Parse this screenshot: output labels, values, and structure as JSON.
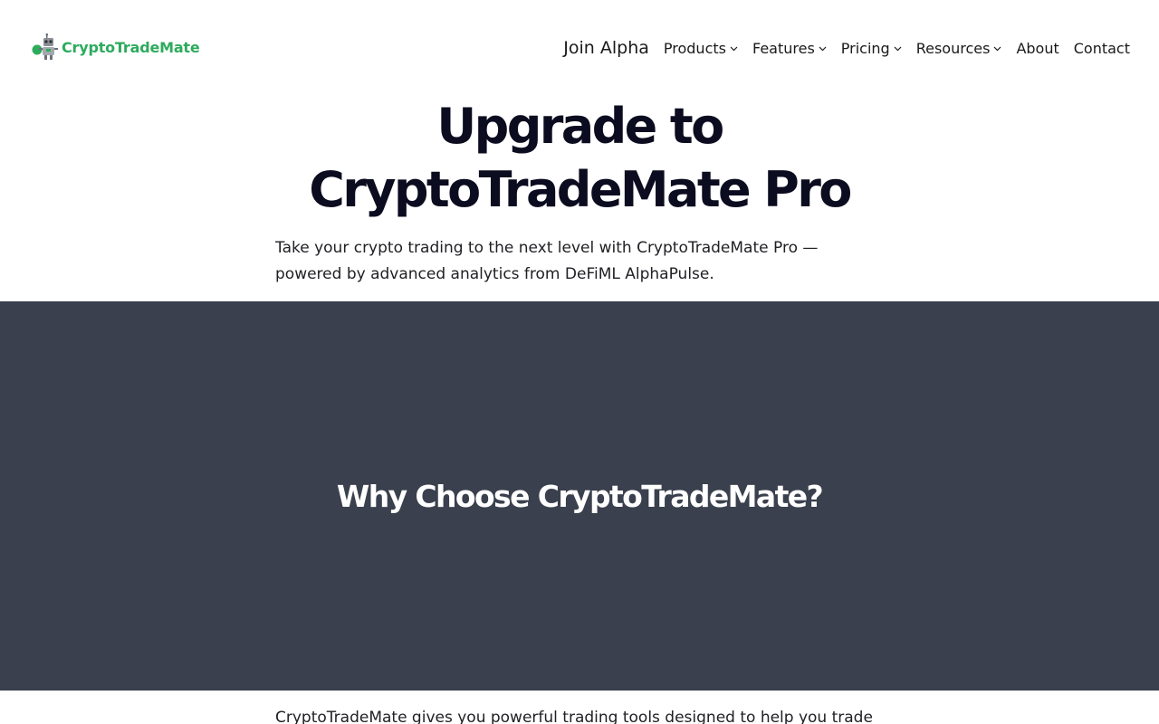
{
  "brand": {
    "name": "CryptoTradeMate",
    "color": "#2dab5d",
    "logo_icon": "robot-icon"
  },
  "nav": {
    "join": "Join Alpha",
    "items": [
      {
        "label": "Products",
        "dropdown": true
      },
      {
        "label": "Features",
        "dropdown": true
      },
      {
        "label": "Pricing",
        "dropdown": true
      },
      {
        "label": "Resources",
        "dropdown": true
      },
      {
        "label": "About",
        "dropdown": false
      },
      {
        "label": "Contact",
        "dropdown": false
      }
    ]
  },
  "hero": {
    "title_line1": "Upgrade to",
    "title_line2": "CryptoTradeMate Pro",
    "subtitle": "Take your crypto trading to the next level with CryptoTradeMate Pro — powered by advanced analytics from DeFiML AlphaPulse."
  },
  "section": {
    "title": "Why Choose CryptoTradeMate?",
    "background": "#3a404d",
    "body": "CryptoTradeMate gives you powerful trading tools designed to help you trade"
  }
}
